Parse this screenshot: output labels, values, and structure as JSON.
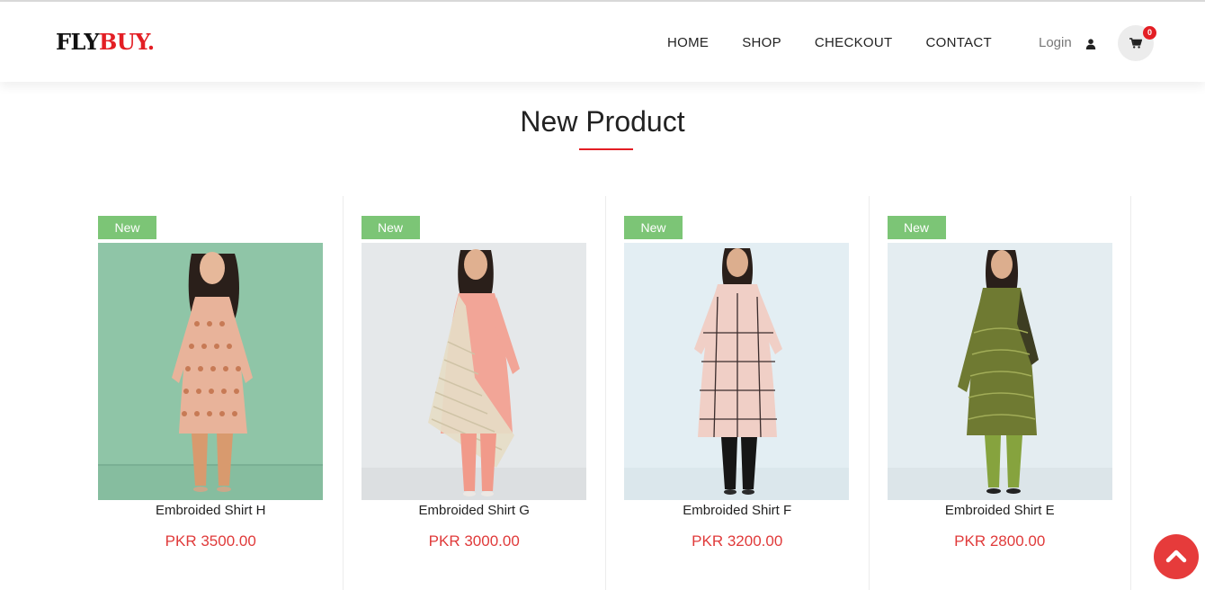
{
  "brand": {
    "part1": "FLY",
    "part2": "BUY."
  },
  "nav": {
    "home": "HOME",
    "shop": "SHOP",
    "checkout": "CHECKOUT",
    "contact": "CONTACT"
  },
  "account": {
    "login_label": "Login",
    "user_icon": "user-icon",
    "cart_icon": "cart-icon",
    "cart_count": "0"
  },
  "section": {
    "title": "New Product"
  },
  "products": [
    {
      "badge": "New",
      "name": "Embroided Shirt H",
      "price": "PKR 3500.00"
    },
    {
      "badge": "New",
      "name": "Embroided Shirt G",
      "price": "PKR 3000.00"
    },
    {
      "badge": "New",
      "name": "Embroided Shirt F",
      "price": "PKR 3200.00"
    },
    {
      "badge": "New",
      "name": "Embroided Shirt E",
      "price": "PKR 2800.00"
    }
  ],
  "scroll_top": {
    "icon": "chevron-up-icon"
  },
  "colors": {
    "accent": "#e31e24",
    "price": "#e03a3a",
    "badge": "#7cc576",
    "scroll_button": "#e63b3b"
  }
}
